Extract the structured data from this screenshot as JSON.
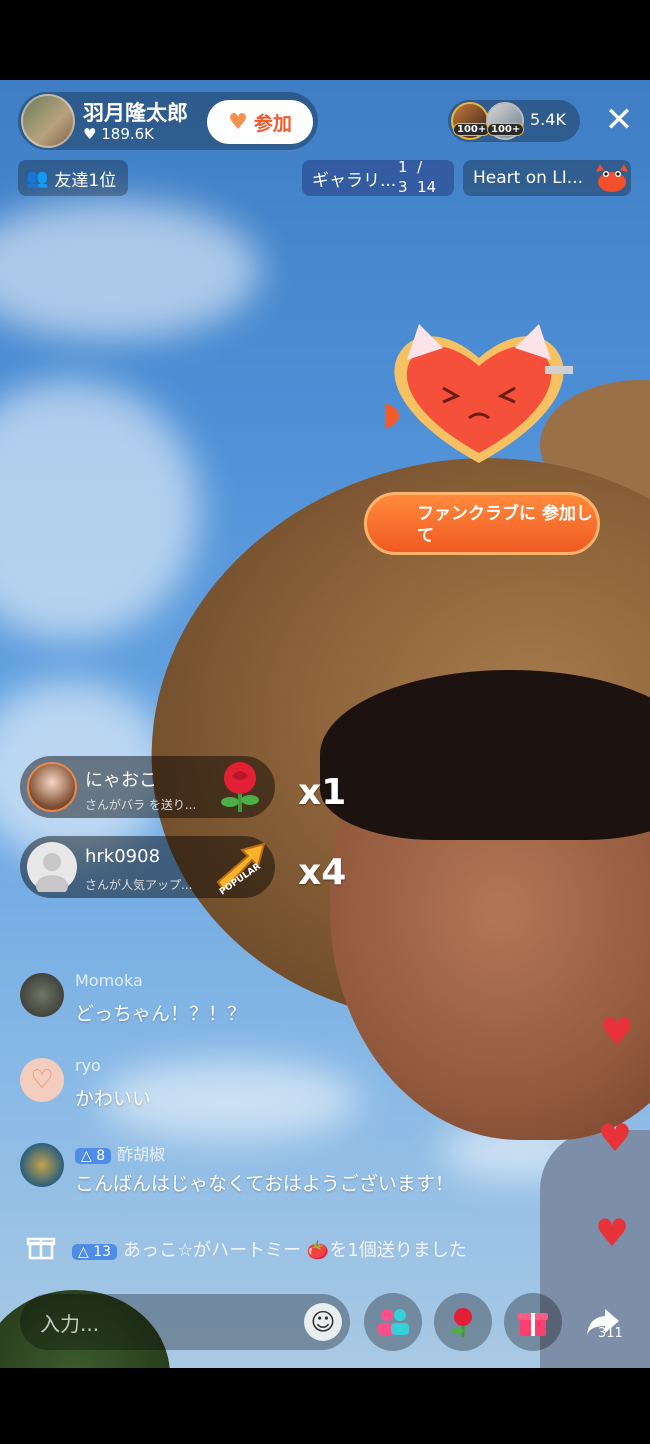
{
  "host": {
    "name": "羽月隆太郎",
    "likes": "189.6K",
    "follow_label": "参加"
  },
  "viewers": {
    "badge_1": "100+",
    "badge_2": "100+",
    "count": "5.4K"
  },
  "chips": {
    "friends": "友達1位",
    "gallery": "ギャラリ...",
    "gallery_current": "1",
    "gallery_sep": "/",
    "gallery_total_left": "3",
    "gallery_total": "14",
    "heart_on": "Heart on LI..."
  },
  "fanclub": {
    "button": "ファンクラブに 参加して"
  },
  "gifts": [
    {
      "name": "にゃおこ",
      "sub": "さんがバラ を送り...",
      "multiplier": "x1"
    },
    {
      "name": "hrk0908",
      "sub": "さんが人気アップ...",
      "multiplier": "x4",
      "icon_label": "POPULAR"
    }
  ],
  "chat": [
    {
      "user": "Momoka",
      "text": "どっちゃん！？！？"
    },
    {
      "user": "ryo",
      "text": "かわいい"
    },
    {
      "user": "酢胡椒",
      "level": "8",
      "text": "こんばんはじゃなくておはようございます！"
    }
  ],
  "system": {
    "level": "13",
    "text": "あっこ☆がハートミー 🍅を1個送りました"
  },
  "bottom": {
    "input_placeholder": "入力...",
    "share_count": "311"
  },
  "colors": {
    "accent_orange": "#f25a2a",
    "heart_red": "#e8323a",
    "level_blue": "#4f8ce6"
  }
}
